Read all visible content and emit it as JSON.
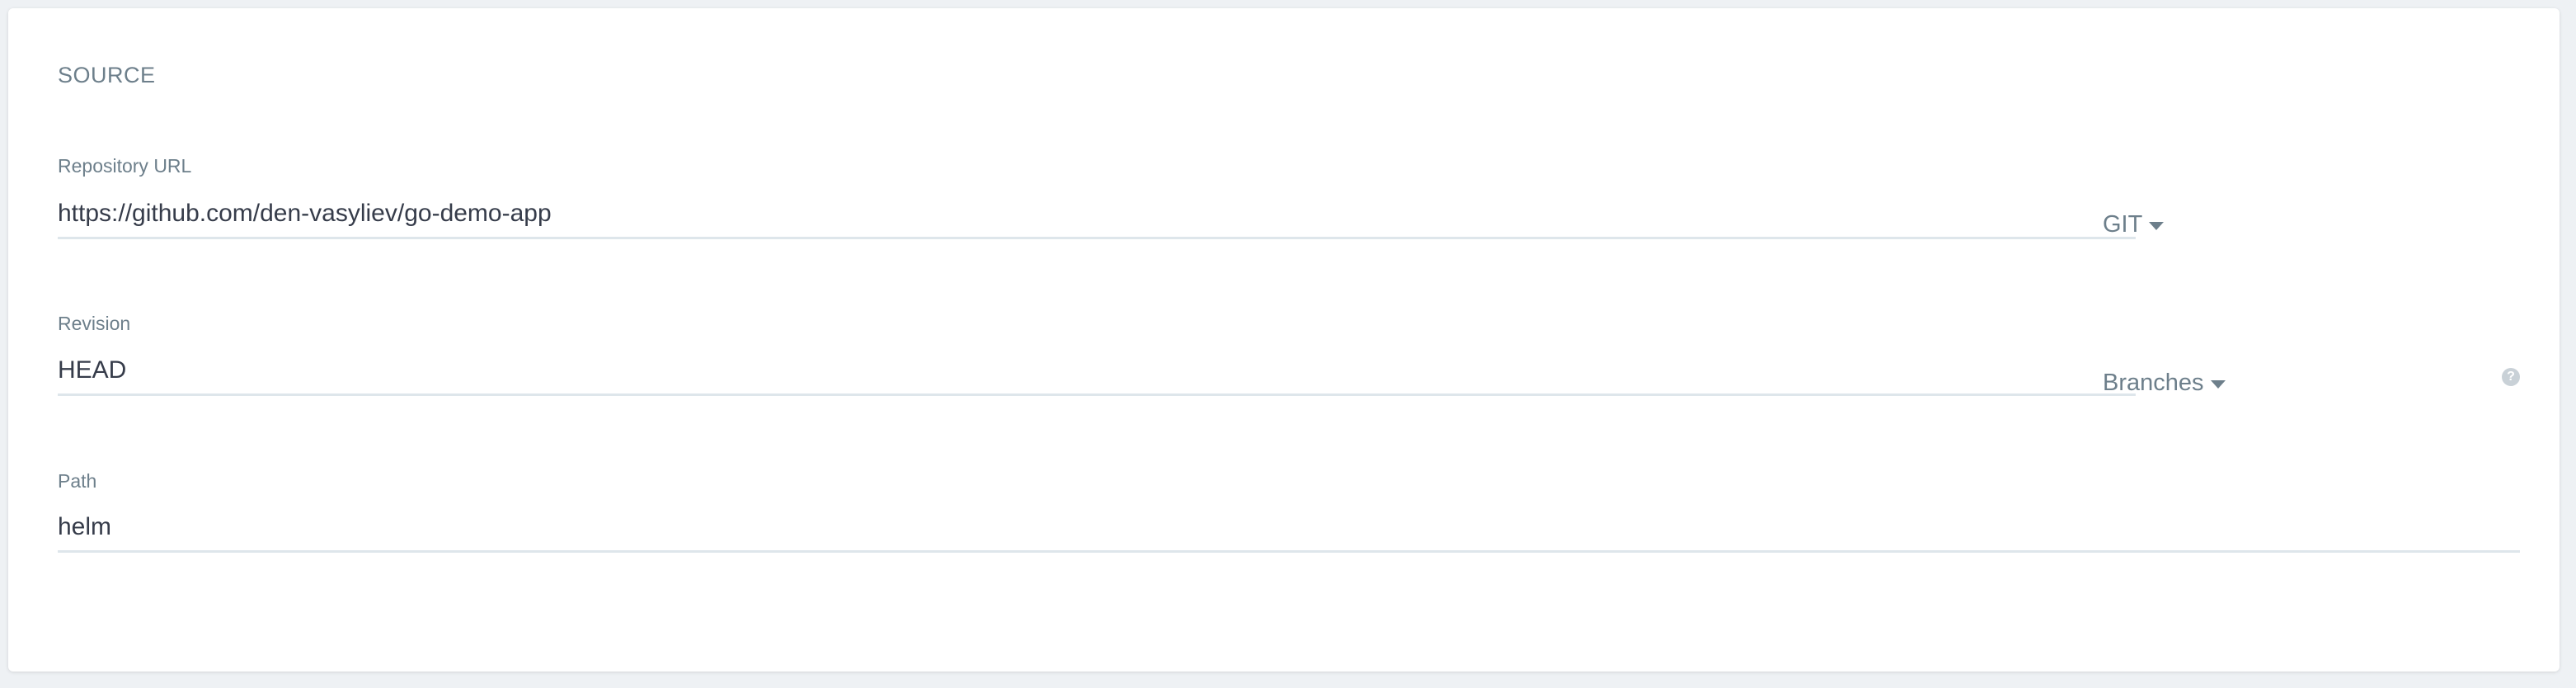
{
  "source": {
    "title": "SOURCE",
    "repository_url": {
      "label": "Repository URL",
      "value": "https://github.com/den-vasyliev/go-demo-app",
      "type_selector": "GIT"
    },
    "revision": {
      "label": "Revision",
      "value": "HEAD",
      "ref_selector": "Branches",
      "help_icon": "question-circle-icon"
    },
    "path": {
      "label": "Path",
      "value": "helm"
    }
  }
}
